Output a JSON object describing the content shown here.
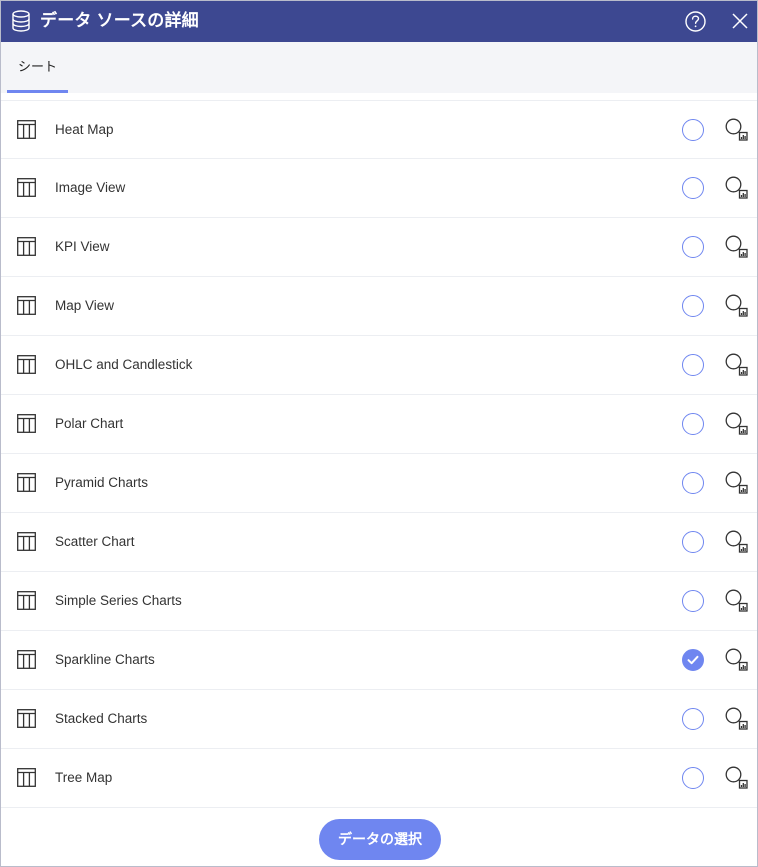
{
  "header": {
    "title": "データ ソースの詳細",
    "background_color": "#3d4891"
  },
  "tabs": [
    {
      "label": "シート",
      "active": true
    }
  ],
  "sheets": [
    {
      "label": "Heat Map",
      "selected": false
    },
    {
      "label": "Image View",
      "selected": false
    },
    {
      "label": "KPI View",
      "selected": false
    },
    {
      "label": "Map View",
      "selected": false
    },
    {
      "label": "OHLC and Candlestick",
      "selected": false
    },
    {
      "label": "Polar Chart",
      "selected": false
    },
    {
      "label": "Pyramid Charts",
      "selected": false
    },
    {
      "label": "Scatter Chart",
      "selected": false
    },
    {
      "label": "Simple Series Charts",
      "selected": false
    },
    {
      "label": "Sparkline Charts",
      "selected": true
    },
    {
      "label": "Stacked Charts",
      "selected": false
    },
    {
      "label": "Tree Map",
      "selected": false
    }
  ],
  "footer": {
    "select_label": "データの選択"
  },
  "accent_color": "#6f86f0",
  "icons": {
    "header": "database-icon",
    "help": "help-icon",
    "close": "close-icon",
    "row": "table-icon",
    "preview": "preview-icon"
  }
}
